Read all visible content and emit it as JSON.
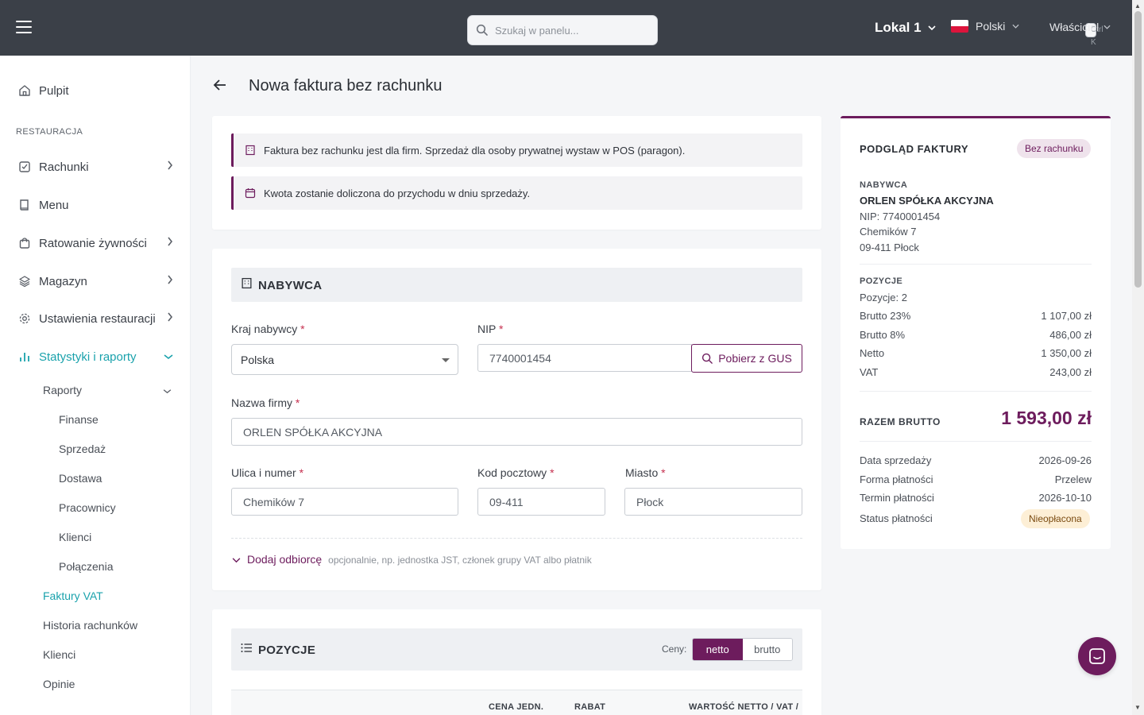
{
  "topbar": {
    "search_placeholder": "Szukaj w panelu...",
    "search_shortcut": "Ctrl K",
    "venue": "Lokal 1",
    "language": "Polski",
    "role": "Właściciel"
  },
  "sidebar": {
    "dashboard": "Pulpit",
    "section": "RESTAURACJA",
    "items": {
      "bills": "Rachunki",
      "menu": "Menu",
      "food_saving": "Ratowanie żywności",
      "warehouse": "Magazyn",
      "settings": "Ustawienia restauracji",
      "stats": "Statystyki i raporty"
    },
    "reports": "Raporty",
    "report_items": [
      "Finanse",
      "Sprzedaż",
      "Dostawa",
      "Pracownicy",
      "Klienci",
      "Połączenia"
    ],
    "vat_invoices": "Faktury VAT",
    "bill_history": "Historia rachunków",
    "clients": "Klienci",
    "reviews": "Opinie"
  },
  "page": {
    "title": "Nowa faktura bez rachunku",
    "notice1": "Faktura bez rachunku jest dla firm. Sprzedaż dla osoby prywatnej wystaw w POS (paragon).",
    "notice2": "Kwota zostanie doliczona do przychodu w dniu sprzedaży."
  },
  "buyer": {
    "section_title": "NABYWCA",
    "country_label": "Kraj nabywcy",
    "country_value": "Polska",
    "nip_label": "NIP",
    "nip_value": "7740001454",
    "gus_button": "Pobierz z GUS",
    "company_label": "Nazwa firmy",
    "company_value": "ORLEN SPÓŁKA AKCYJNA",
    "street_label": "Ulica i numer",
    "street_value": "Chemików 7",
    "postcode_label": "Kod pocztowy",
    "postcode_value": "09-411",
    "city_label": "Miasto",
    "city_value": "Płock",
    "add_recipient": "Dodaj odbiorcę",
    "add_recipient_hint": "opcjonalnie, np. jednostka JST, członek grupy VAT albo płatnik",
    "required_mark": "*"
  },
  "positions": {
    "section_title": "POZYCJE",
    "prices_label": "Ceny:",
    "netto": "netto",
    "brutto": "brutto",
    "col_unit_price": "CENA JEDN.",
    "col_discount": "RABAT",
    "col_value": "WARTOŚĆ NETTO / VAT /"
  },
  "preview": {
    "title": "PODGLĄD FAKTURY",
    "badge": "Bez rachunku",
    "buyer_label": "NABYWCA",
    "buyer_name": "ORLEN SPÓŁKA AKCYJNA",
    "buyer_nip": "NIP: 7740001454",
    "buyer_street": "Chemików 7",
    "buyer_city": "09-411 Płock",
    "positions_label": "POZYCJE",
    "positions_count": "Pozycje: 2",
    "rows": [
      {
        "label": "Brutto 23%",
        "value": "1 107,00 zł"
      },
      {
        "label": "Brutto 8%",
        "value": "486,00 zł"
      },
      {
        "label": "Netto",
        "value": "1 350,00 zł"
      },
      {
        "label": "VAT",
        "value": "243,00 zł"
      }
    ],
    "total_label": "RAZEM BRUTTO",
    "total_value": "1 593,00 zł",
    "details": [
      {
        "label": "Data sprzedaży",
        "value": "2026-09-26"
      },
      {
        "label": "Forma płatności",
        "value": "Przelew"
      },
      {
        "label": "Termin płatności",
        "value": "2026-10-10"
      }
    ],
    "payment_status_label": "Status płatności",
    "payment_status": "Nieopłacona"
  },
  "colors": {
    "brand": "#6d1c5d",
    "accent": "#1aa2ac",
    "topbar": "#3b4048"
  }
}
